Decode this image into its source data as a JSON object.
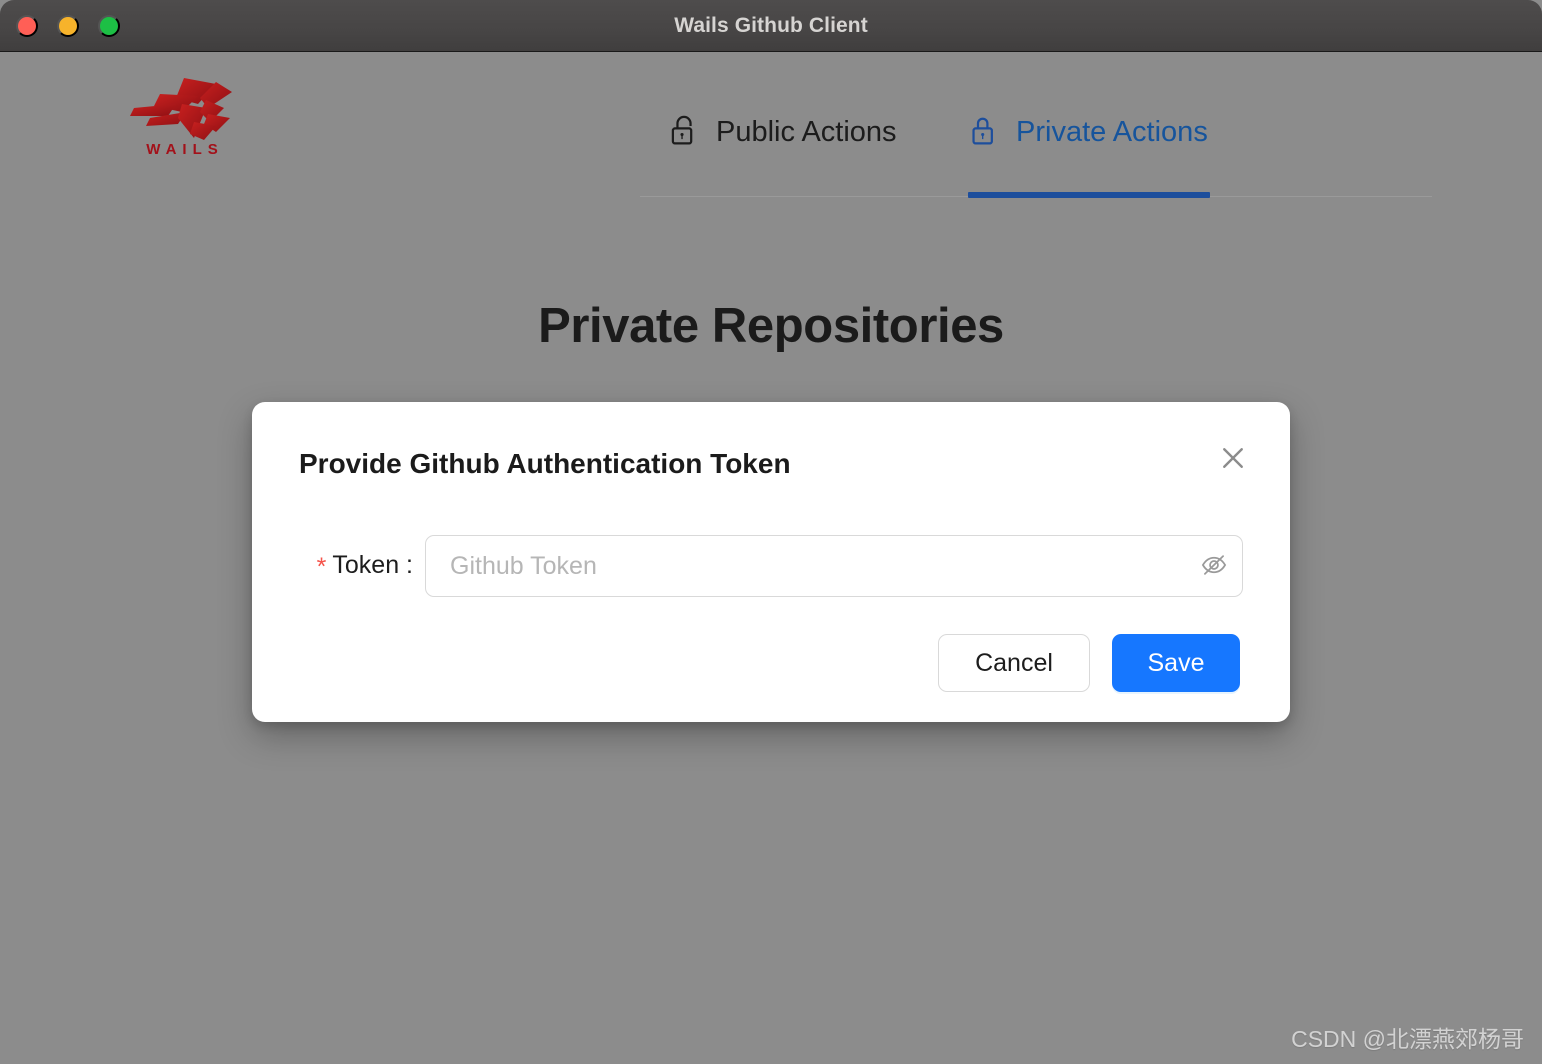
{
  "window": {
    "title": "Wails Github Client",
    "traffic_lights": [
      {
        "name": "close",
        "color": "#ff5f56"
      },
      {
        "name": "minimize",
        "color": "#f7b32b"
      },
      {
        "name": "maximize",
        "color": "#1dbf45"
      }
    ],
    "titlebar_bg": "#474545",
    "body_bg": "#8c8c8c"
  },
  "logo": {
    "wordmark": "WAILS",
    "color": "#a3111a"
  },
  "tabs": {
    "items": [
      {
        "label": "Public Actions",
        "icon": "unlock-icon",
        "active": false,
        "color": "#1c1c1c"
      },
      {
        "label": "Private Actions",
        "icon": "lock-icon",
        "active": true,
        "color": "#16549c"
      }
    ],
    "active_color": "#1d4e9c"
  },
  "main": {
    "page_title": "Private Repositories"
  },
  "modal": {
    "title": "Provide Github Authentication Token",
    "close_icon": "close-icon",
    "form": {
      "label": "Token :",
      "required_marker": "*",
      "required_color": "#f5544b",
      "input_value": "",
      "input_placeholder": "Github Token",
      "visibility_icon": "eye-slash-icon"
    },
    "buttons": {
      "cancel_label": "Cancel",
      "save_label": "Save",
      "save_color": "#1677ff"
    }
  },
  "watermark": {
    "text": "CSDN @北漂燕郊杨哥"
  }
}
